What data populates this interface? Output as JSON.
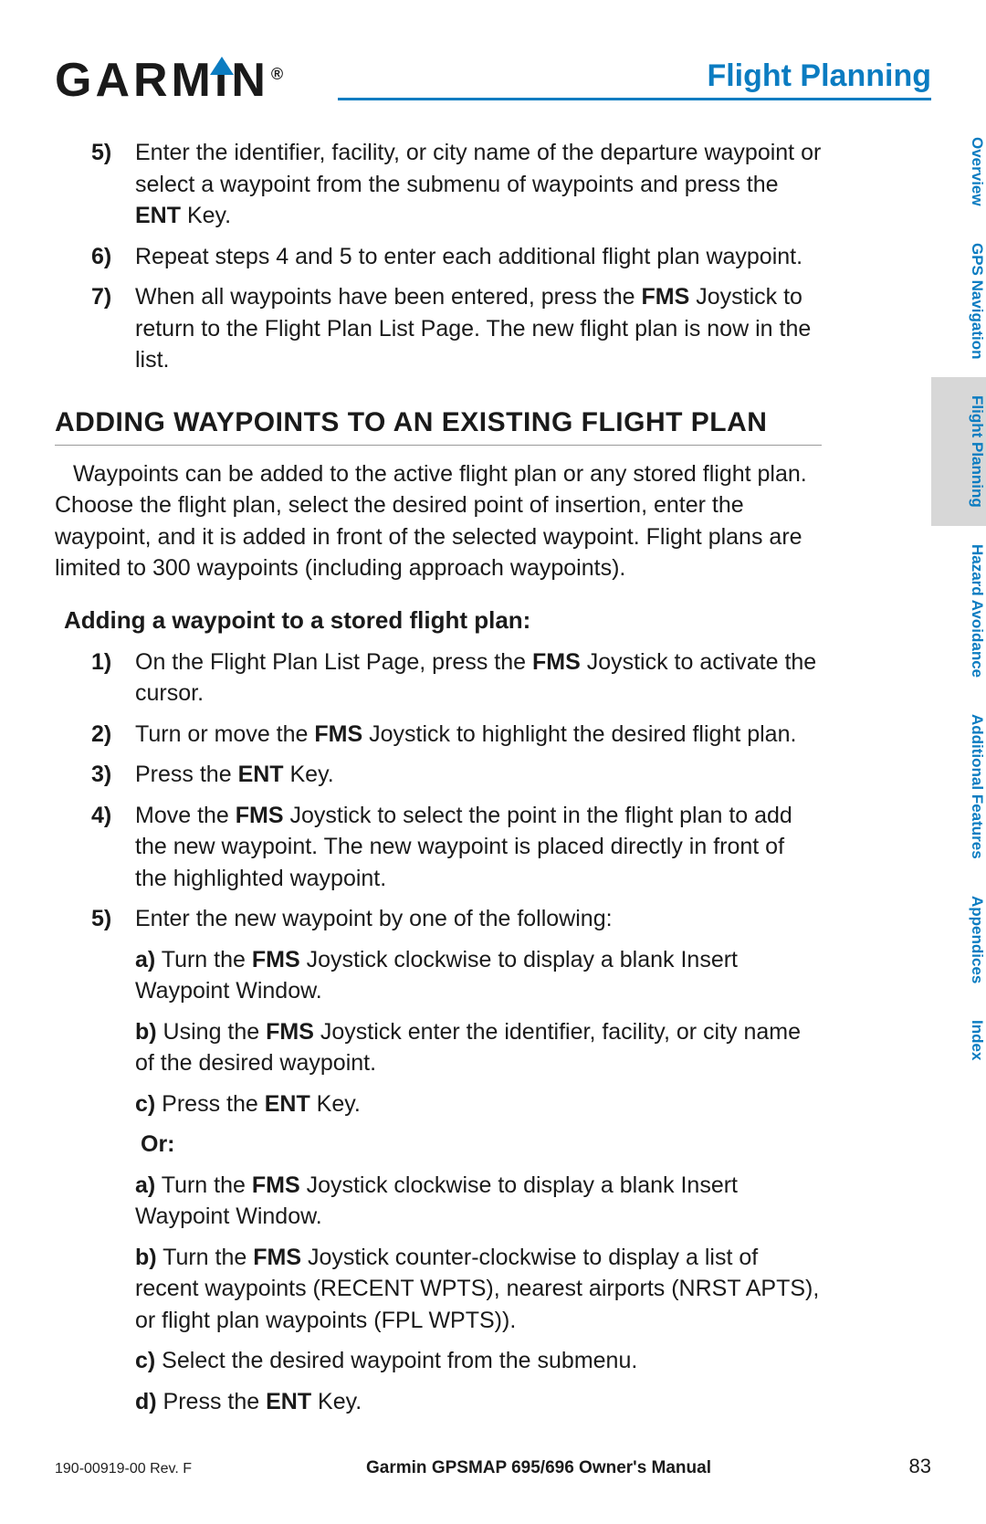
{
  "brand": "GARMIN",
  "section_title": "Flight Planning",
  "steps_top": [
    {
      "n": "5)",
      "pre": "Enter the identifier, facility, or city name of the departure waypoint or select a waypoint from the submenu of  waypoints and press the ",
      "b1": "ENT",
      "post": " Key."
    },
    {
      "n": "6)",
      "text": "Repeat steps 4 and 5 to enter each additional flight plan waypoint."
    },
    {
      "n": "7)",
      "pre": "When all waypoints have been entered, press the ",
      "b1": "FMS",
      "post": " Joystick to return to the Flight Plan List Page.  The new flight plan is now in the list."
    }
  ],
  "h2": "ADDING WAYPOINTS TO AN EXISTING FLIGHT PLAN",
  "intro": "Waypoints can be added to the active flight plan or any stored flight plan.  Choose the flight plan, select the desired point of insertion, enter the waypoint, and it is added in front of the selected waypoint.  Flight plans are limited to 300 waypoints (including approach waypoints).",
  "h3": "Adding a waypoint to a stored flight plan:",
  "steps_main": {
    "s1": {
      "n": "1)",
      "pre": "On the Flight Plan List Page, press the ",
      "b": "FMS",
      "post": " Joystick to activate the cursor."
    },
    "s2": {
      "n": "2)",
      "pre": "Turn or move the ",
      "b": "FMS",
      "post": " Joystick to highlight the desired flight plan."
    },
    "s3": {
      "n": "3)",
      "pre": "Press the ",
      "b": "ENT",
      "post": " Key."
    },
    "s4": {
      "n": "4)",
      "pre": "Move the ",
      "b": "FMS",
      "post": " Joystick to select the point in the flight plan to add the new waypoint.  The new waypoint is placed directly in front of the highlighted waypoint."
    },
    "s5": {
      "n": "5)",
      "text": "Enter the new waypoint by one of the following:"
    }
  },
  "sub_a1": {
    "lbl": "a)",
    "pre": " Turn the ",
    "b": "FMS",
    "post": " Joystick clockwise to display a blank Insert Waypoint Window."
  },
  "sub_b1": {
    "lbl": "b)",
    "pre": " Using the ",
    "b": "FMS",
    "post": " Joystick enter the identifier, facility, or city name of the desired waypoint."
  },
  "sub_c1": {
    "lbl": "c)",
    "pre": " Press the ",
    "b": "ENT",
    "post": " Key."
  },
  "or_label": "Or:",
  "sub_a2": {
    "lbl": "a)",
    "pre": " Turn the ",
    "b": "FMS",
    "post": " Joystick clockwise to display a blank Insert Waypoint Window."
  },
  "sub_b2": {
    "lbl": "b)",
    "pre": " Turn the ",
    "b": "FMS",
    "post": " Joystick counter-clockwise to display a list of recent waypoints (RECENT WPTS), nearest airports (NRST APTS), or flight plan waypoints (FPL WPTS))."
  },
  "sub_c2": {
    "lbl": "c)",
    "text": " Select the desired waypoint from the submenu."
  },
  "sub_d2": {
    "lbl": "d)",
    "pre": " Press the ",
    "b": "ENT",
    "post": " Key."
  },
  "tabs": [
    {
      "label": "Overview",
      "active": false
    },
    {
      "label": "GPS Navigation",
      "active": false
    },
    {
      "label": "Flight Planning",
      "active": true
    },
    {
      "label": "Hazard Avoidance",
      "active": false
    },
    {
      "label": "Additional Features",
      "active": false
    },
    {
      "label": "Appendices",
      "active": false
    },
    {
      "label": "Index",
      "active": false
    }
  ],
  "footer": {
    "rev": "190-00919-00 Rev. F",
    "manual": "Garmin GPSMAP 695/696 Owner's Manual",
    "page": "83"
  }
}
